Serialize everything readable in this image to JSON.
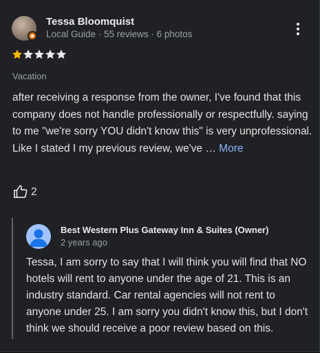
{
  "review": {
    "reviewer_name": "Tessa Bloomquist",
    "reviewer_meta": "Local Guide · 55 reviews · 6 photos",
    "rating": 1,
    "max_rating": 5,
    "tag": "Vacation",
    "text": "after receiving a response from the owner, I've found that this company does not handle professionally or respectfully. saying to me \"we're sorry YOU didn't know this\" is very unprofessional. Like I stated I my previous review, we've …",
    "more_label": "More",
    "like_count": "2",
    "avatar_icon": "local-guide-badge-icon",
    "menu_icon": "more-vert-icon"
  },
  "owner_reply": {
    "name": "Best Western Plus Gateway Inn & Suites (Owner)",
    "time": "2 years ago",
    "text": "Tessa, I am sorry to say that I will think you will find that NO hotels will rent to anyone under the age of 21. This is an industry standard. Car rental agencies will not rent to anyone under 25. I am sorry you didn't know this, but I don't think we should receive a poor review based on this.",
    "avatar_icon": "default-person-icon"
  },
  "colors": {
    "background": "#202124",
    "star_filled": "#fbbc04",
    "star_empty": "#e8eaed",
    "link": "#8ab4f8",
    "secondary_text": "#9aa0a6",
    "badge": "#e8710a",
    "owner_avatar": "#a0c3ff"
  }
}
